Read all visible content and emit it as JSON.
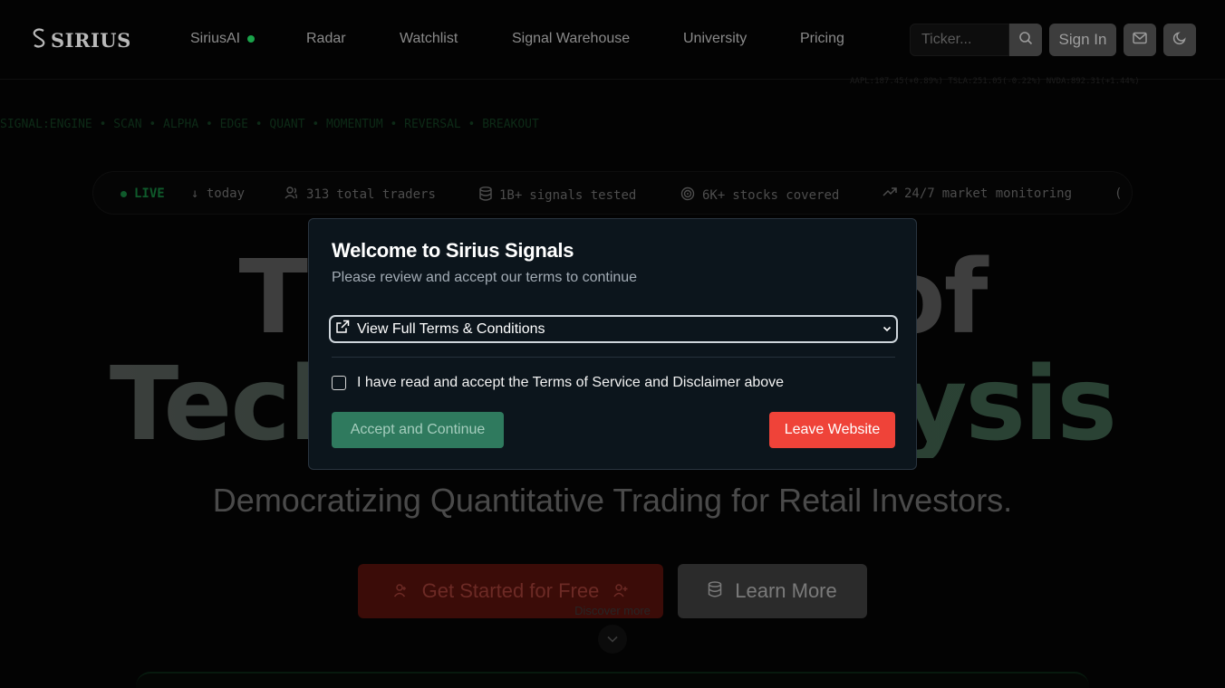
{
  "header": {
    "logo_text": "SIRIUS",
    "nav": [
      {
        "label": "SiriusAI"
      },
      {
        "label": "Radar"
      },
      {
        "label": "Watchlist"
      },
      {
        "label": "Signal Warehouse"
      },
      {
        "label": "University"
      },
      {
        "label": "Pricing"
      }
    ],
    "search_placeholder": "Ticker...",
    "sign_in_label": "Sign In",
    "status_strip": "AAPL:187.45(+0.89%) TSLA:251.05(-0.22%) NVDA:892.31(+1.44%)"
  },
  "marquee_text": "SIGNAL:ENGINE • SCAN • ALPHA • EDGE • QUANT • MOMENTUM • REVERSAL • BREAKOUT",
  "stats_bar": {
    "live_label": "LIVE",
    "items": [
      {
        "icon": "activity-icon",
        "text": "↓ today"
      },
      {
        "icon": "users-icon",
        "value": "313",
        "label": "total traders"
      },
      {
        "icon": "database-icon",
        "value": "1B+",
        "label": "signals tested"
      },
      {
        "icon": "target-icon",
        "value": "6K+",
        "label": "stocks covered"
      },
      {
        "icon": "trending-up-icon",
        "value": "24/7",
        "label": "market monitoring"
      },
      {
        "icon": "clock-icon",
        "text": "("
      }
    ]
  },
  "hero": {
    "line1": "The Future of",
    "line2": "Technical Analysis",
    "subtitle": "Democratizing Quantitative Trading for Retail Investors.",
    "primary_cta": "Get Started for Free",
    "secondary_cta": "Learn More",
    "discover": "Discover more"
  },
  "modal": {
    "title": "Welcome to Sirius Signals",
    "description": "Please review and accept our terms to continue",
    "terms_link": "View Full Terms & Conditions",
    "checkbox_label": "I have read and accept the Terms of Service and Disclaimer above",
    "accept_label": "Accept and Continue",
    "leave_label": "Leave Website"
  },
  "colors": {
    "modal_bg": "#0c151c",
    "accept_green": "#2f7a5e",
    "leave_red": "#ef4339",
    "live_green": "#1aa34a"
  }
}
